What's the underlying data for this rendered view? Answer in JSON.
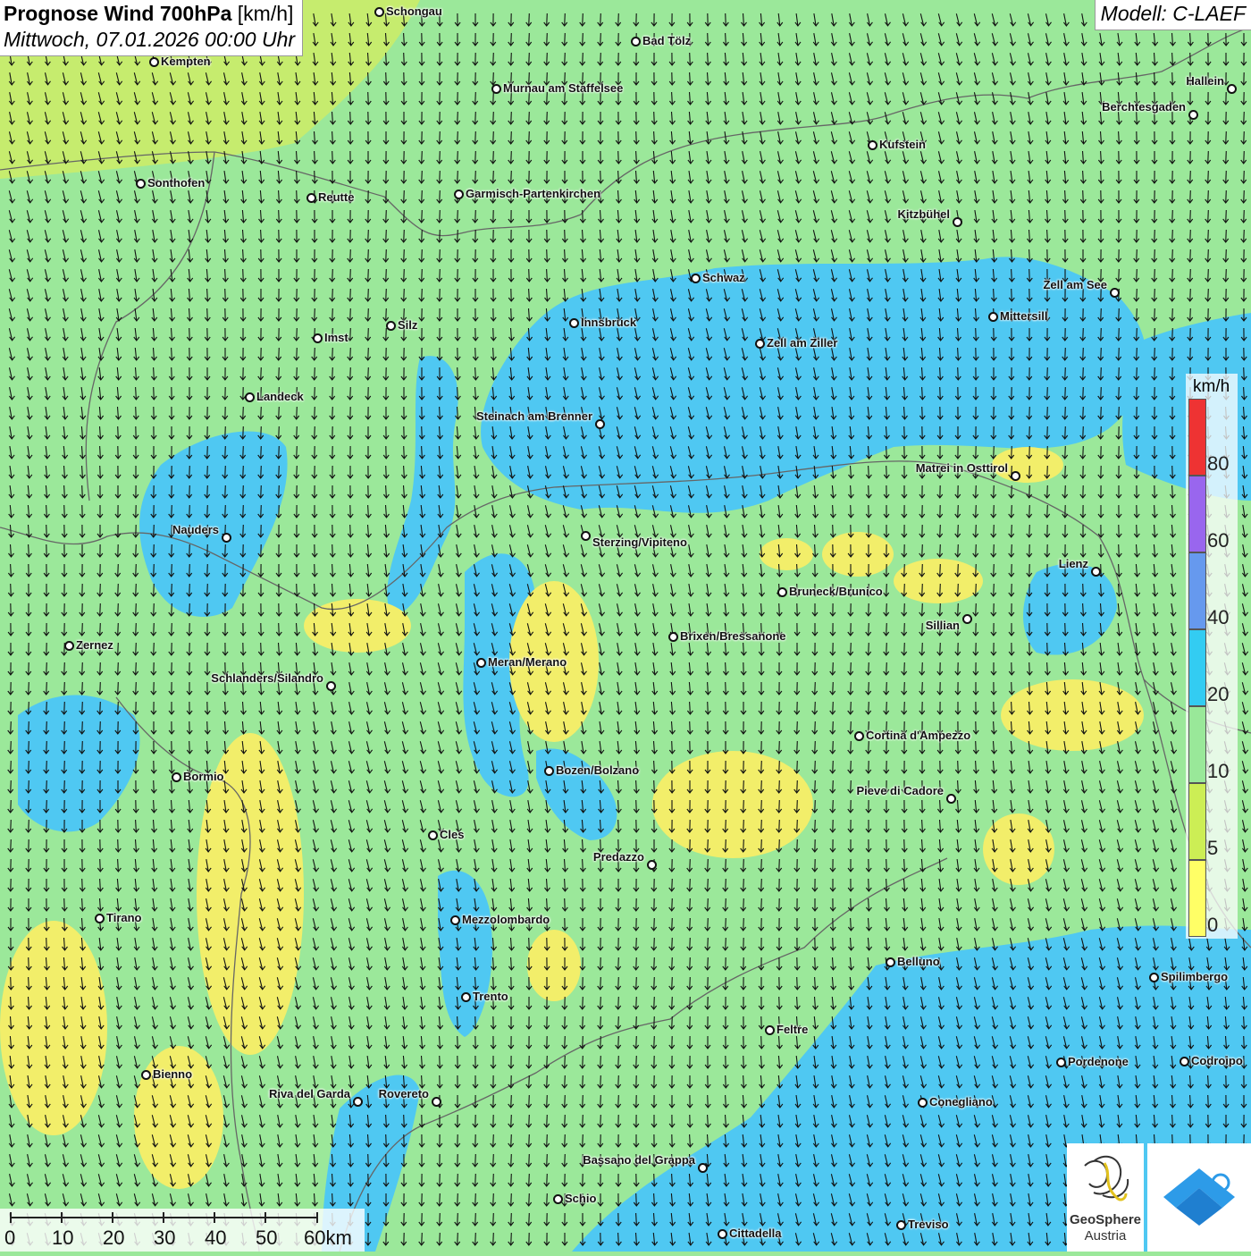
{
  "header": {
    "title": "Prognose Wind 700hPa",
    "unit": "[km/h]",
    "datetime": "Mittwoch, 07.01.2026 00:00 Uhr",
    "model": "Modell: C-LAEF"
  },
  "legend": {
    "unit": "km/h",
    "labels": [
      "80",
      "60",
      "40",
      "20",
      "10",
      "5",
      "0"
    ],
    "colors": [
      "#ee3333",
      "#9966ee",
      "#6699ee",
      "#33ccf2",
      "#99e899",
      "#ccee55",
      "#ffff66"
    ]
  },
  "cities": [
    {
      "name": "Schongau"
    },
    {
      "name": "Bad Tölz"
    },
    {
      "name": "Kempten"
    },
    {
      "name": "Murnau am Staffelsee"
    },
    {
      "name": "Hallein"
    },
    {
      "name": "Berchtesgaden"
    },
    {
      "name": "Kufstein"
    },
    {
      "name": "Sonthofen"
    },
    {
      "name": "Reutte"
    },
    {
      "name": "Garmisch-Partenkirchen"
    },
    {
      "name": "Kitzbühel"
    },
    {
      "name": "Schwaz"
    },
    {
      "name": "Zell am See"
    },
    {
      "name": "Mittersill"
    },
    {
      "name": "Innsbruck"
    },
    {
      "name": "Silz"
    },
    {
      "name": "Imst"
    },
    {
      "name": "Zell am Ziller"
    },
    {
      "name": "Landeck"
    },
    {
      "name": "Steinach am Brenner"
    },
    {
      "name": "Matrei in Osttirol"
    },
    {
      "name": "Nauders"
    },
    {
      "name": "Sterzing/Vipiteno"
    },
    {
      "name": "Lienz"
    },
    {
      "name": "Bruneck/Brunico"
    },
    {
      "name": "Sillian"
    },
    {
      "name": "Brixen/Bressanone"
    },
    {
      "name": "Zernez"
    },
    {
      "name": "Meran/Merano"
    },
    {
      "name": "Schlanders/Silandro"
    },
    {
      "name": "Cortina d'Ampezzo"
    },
    {
      "name": "Bozen/Bolzano"
    },
    {
      "name": "Bormio"
    },
    {
      "name": "Pieve di Cadore"
    },
    {
      "name": "Cles"
    },
    {
      "name": "Predazzo"
    },
    {
      "name": "Tirano"
    },
    {
      "name": "Mezzolombardo"
    },
    {
      "name": "Belluno"
    },
    {
      "name": "Spilimbergo"
    },
    {
      "name": "Trento"
    },
    {
      "name": "Feltre"
    },
    {
      "name": "Pordenone"
    },
    {
      "name": "Codroipo"
    },
    {
      "name": "Bienno"
    },
    {
      "name": "Riva del Garda"
    },
    {
      "name": "Rovereto"
    },
    {
      "name": "Conegliano"
    },
    {
      "name": "Bassano del Grappa"
    },
    {
      "name": "Schio"
    },
    {
      "name": "Treviso"
    },
    {
      "name": "Cittadella"
    }
  ],
  "scalebar": {
    "labels": [
      "0",
      "10",
      "20",
      "30",
      "40",
      "50",
      "60km"
    ]
  },
  "logo": {
    "line1": "GeoSphere",
    "line2": "Austria"
  }
}
